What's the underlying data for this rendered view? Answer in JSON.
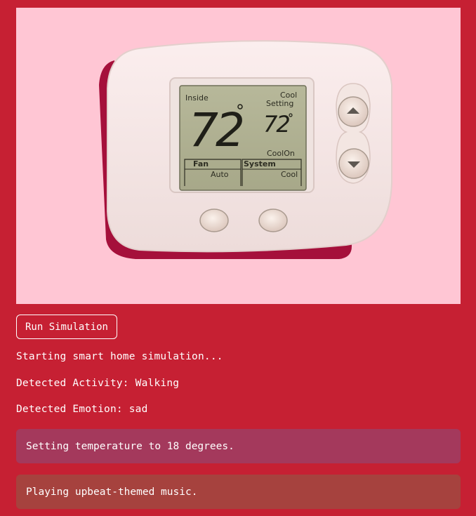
{
  "hero": {
    "image_name": "thermostat-image",
    "display": {
      "inside_label": "Inside",
      "inside_temp": "72",
      "cool_label": "Cool",
      "setting_label": "Setting",
      "setting_temp": "72",
      "coolon_label": "CoolOn",
      "fan_label": "Fan",
      "fan_value": "Auto",
      "system_label": "System",
      "system_value": "Cool"
    }
  },
  "controls": {
    "run_label": "Run Simulation"
  },
  "log": {
    "line1": "Starting smart home simulation...",
    "line2": "Detected Activity: Walking",
    "line3": "Detected Emotion: sad"
  },
  "actions": {
    "temperature": "Setting temperature to 18 degrees.",
    "music": "Playing upbeat-themed music."
  },
  "colors": {
    "page_bg": "#c62033",
    "hero_bg": "#ffc6d4",
    "temp_panel": "#a4395c",
    "music_panel": "#a6423e"
  }
}
